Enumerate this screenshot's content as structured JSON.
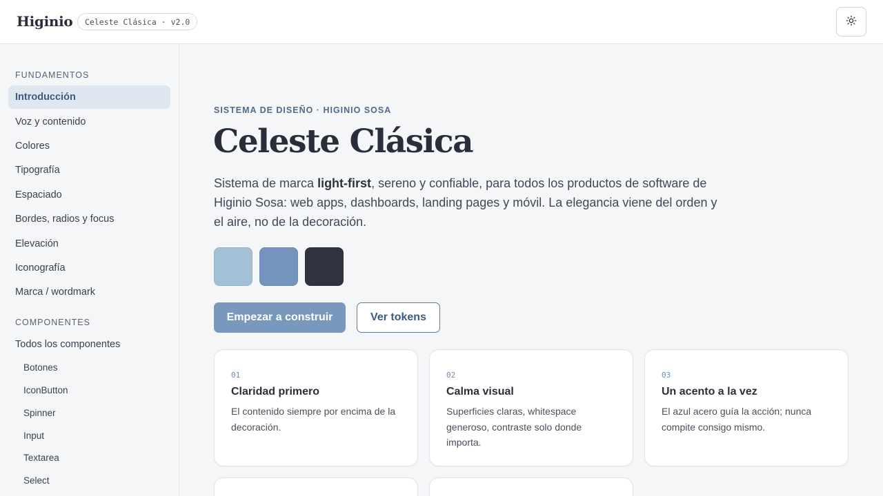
{
  "header": {
    "brand": "Higinio",
    "version_pill": "Celeste Clásica · v2.0",
    "theme_toggle_icon": "sun-icon"
  },
  "sidebar": {
    "sections": [
      {
        "heading": "FUNDAMENTOS",
        "items": [
          {
            "label": "Introducción",
            "active": true
          },
          {
            "label": "Voz y contenido"
          },
          {
            "label": "Colores"
          },
          {
            "label": "Tipografía"
          },
          {
            "label": "Espaciado"
          },
          {
            "label": "Bordes, radios y focus"
          },
          {
            "label": "Elevación"
          },
          {
            "label": "Iconografía"
          },
          {
            "label": "Marca / wordmark"
          }
        ]
      },
      {
        "heading": "COMPONENTES",
        "items": [
          {
            "label": "Todos los componentes"
          }
        ],
        "subitems": [
          "Botones",
          "IconButton",
          "Spinner",
          "Input",
          "Textarea",
          "Select"
        ]
      }
    ]
  },
  "main": {
    "eyebrow": "SISTEMA DE DISEÑO · HIGINIO SOSA",
    "title": "Celeste Clásica",
    "lead_pre": "Sistema de marca ",
    "lead_bold": "light-first",
    "lead_post": ", sereno y confiable, para todos los productos de software de Higinio Sosa: web apps, dashboards, landing pages y móvil. La elegancia viene del orden y el aire, no de la decoración.",
    "swatches": [
      "#a3c1d6",
      "#7394bd",
      "#30333f"
    ],
    "primary_button": "Empezar a construir",
    "secondary_button": "Ver tokens",
    "cards": [
      {
        "num": "01",
        "title": "Claridad primero",
        "body": "El contenido siempre por encima de la decoración."
      },
      {
        "num": "02",
        "title": "Calma visual",
        "body": "Superficies claras, whitespace generoso, contraste solo donde importa."
      },
      {
        "num": "03",
        "title": "Un acento a la vez",
        "body": "El azul acero guía la acción; nunca compite consigo mismo."
      }
    ]
  }
}
